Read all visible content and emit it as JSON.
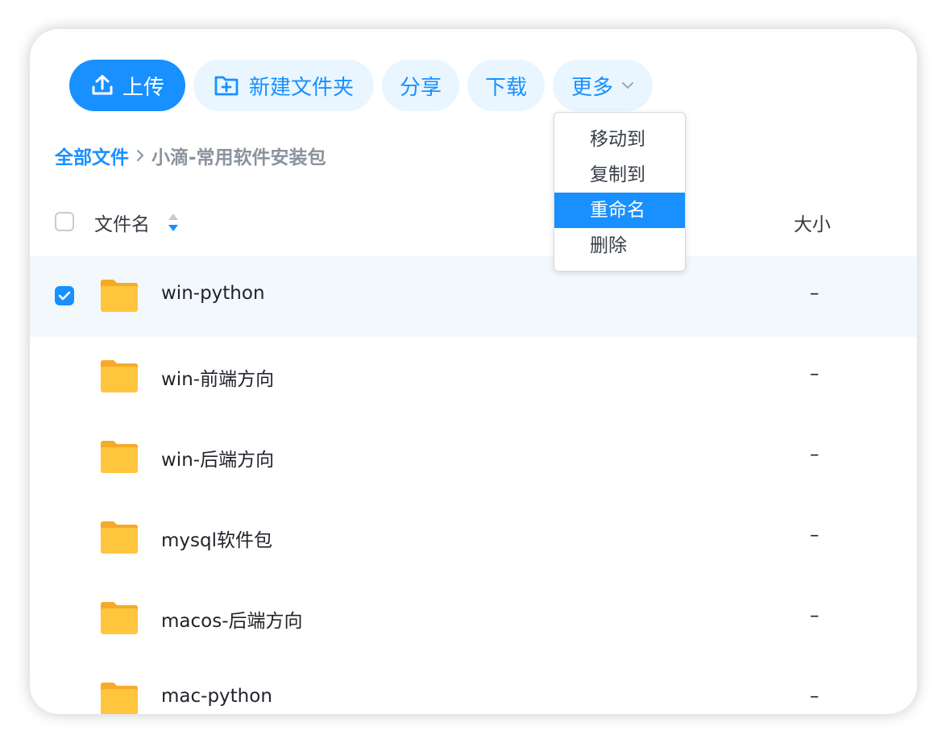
{
  "toolbar": {
    "upload_label": "上传",
    "new_folder_label": "新建文件夹",
    "share_label": "分享",
    "download_label": "下载",
    "more_label": "更多"
  },
  "breadcrumb": {
    "root": "全部文件",
    "current": "小滴-常用软件安装包"
  },
  "table": {
    "col_name": "文件名",
    "col_size": "大小",
    "rows": [
      {
        "name": "win-python",
        "size": "–",
        "selected": true
      },
      {
        "name": "win-前端方向",
        "size": "–",
        "selected": false
      },
      {
        "name": "win-后端方向",
        "size": "–",
        "selected": false
      },
      {
        "name": "mysql软件包",
        "size": "–",
        "selected": false
      },
      {
        "name": "macos-后端方向",
        "size": "–",
        "selected": false
      },
      {
        "name": "mac-python",
        "size": "–",
        "selected": false
      }
    ]
  },
  "more_menu": {
    "items": [
      {
        "label": "移动到",
        "active": false
      },
      {
        "label": "复制到",
        "active": false
      },
      {
        "label": "重命名",
        "active": true
      },
      {
        "label": "删除",
        "active": false
      }
    ]
  },
  "colors": {
    "primary": "#1890ff",
    "light_button": "#eaf6ff",
    "selected_row": "#f3f8fd",
    "folder": "#ffc53d"
  },
  "icons": {
    "upload": "upload-icon",
    "new_folder": "folder-plus-icon",
    "more": "chevron-down-icon",
    "breadcrumb_separator": "chevron-right-icon",
    "sort": "sort-icon",
    "folder": "folder-icon",
    "check": "check-icon"
  }
}
